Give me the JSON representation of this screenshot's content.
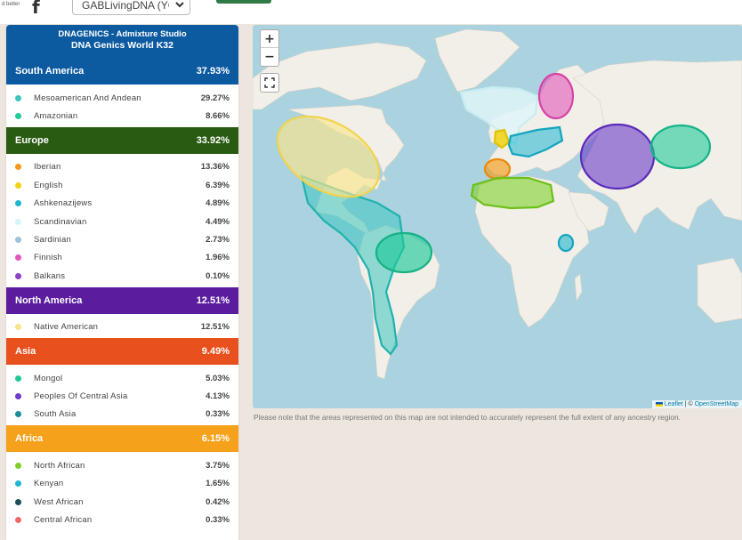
{
  "header": {
    "logo_text": "d better",
    "select_value": "GABLivingDNA (YCC",
    "colors": {
      "green_button": "#2f7a45"
    }
  },
  "panel": {
    "title_line1": "DNAGENICS - Admixture Studio",
    "title_line2": "DNA Genics World K32",
    "colors": {
      "header": "#0c5aa0"
    },
    "regions": [
      {
        "name": "South America",
        "percent": "37.93%",
        "color": "#0c5aa0",
        "items": [
          {
            "name": "Mesoamerican And Andean",
            "percent": "29.27%",
            "color": "#3cc4c0"
          },
          {
            "name": "Amazonian",
            "percent": "8.66%",
            "color": "#1fc99a"
          }
        ]
      },
      {
        "name": "Europe",
        "percent": "33.92%",
        "color": "#2a5b12",
        "items": [
          {
            "name": "Iberian",
            "percent": "13.36%",
            "color": "#f39a1a"
          },
          {
            "name": "English",
            "percent": "6.39%",
            "color": "#f2d313"
          },
          {
            "name": "Ashkenazijews",
            "percent": "4.89%",
            "color": "#1eb6cf"
          },
          {
            "name": "Scandinavian",
            "percent": "4.49%",
            "color": "#d6f4f7"
          },
          {
            "name": "Sardinian",
            "percent": "2.73%",
            "color": "#9ec3d6"
          },
          {
            "name": "Finnish",
            "percent": "1.96%",
            "color": "#e157b7"
          },
          {
            "name": "Balkans",
            "percent": "0.10%",
            "color": "#8e3fc7"
          }
        ]
      },
      {
        "name": "North America",
        "percent": "12.51%",
        "color": "#5b1c9e",
        "items": [
          {
            "name": "Native American",
            "percent": "12.51%",
            "color": "#f9e48a"
          }
        ]
      },
      {
        "name": "Asia",
        "percent": "9.49%",
        "color": "#e8501d",
        "items": [
          {
            "name": "Mongol",
            "percent": "5.03%",
            "color": "#1fc99a"
          },
          {
            "name": "Peoples Of Central Asia",
            "percent": "4.13%",
            "color": "#6a3bc9"
          },
          {
            "name": "South Asia",
            "percent": "0.33%",
            "color": "#1a8e98"
          }
        ]
      },
      {
        "name": "Africa",
        "percent": "6.15%",
        "color": "#f5a11b",
        "items": [
          {
            "name": "North African",
            "percent": "3.75%",
            "color": "#7fd12a"
          },
          {
            "name": "Kenyan",
            "percent": "1.65%",
            "color": "#1eb6cf"
          },
          {
            "name": "West African",
            "percent": "0.42%",
            "color": "#1f4d57"
          },
          {
            "name": "Central African",
            "percent": "0.33%",
            "color": "#f06a6a"
          }
        ]
      }
    ]
  },
  "map": {
    "zoom_in": "+",
    "zoom_out": "−",
    "attribution_leaflet": "Leaflet",
    "attribution_sep": " | © ",
    "attribution_osm": "OpenStreetMap",
    "land_color": "#f2efe9",
    "water_color": "#aad3df"
  },
  "note": "Please note that the areas represented on this map are not intended to accurately represent the full extent of any ancestry region."
}
